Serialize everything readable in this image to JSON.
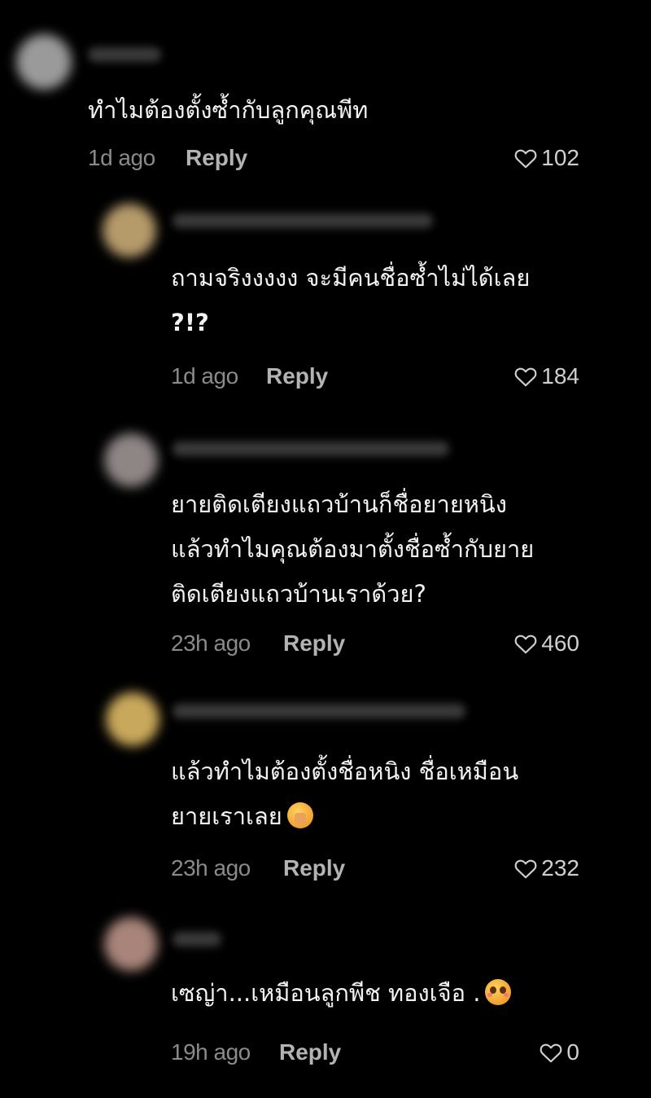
{
  "comments": [
    {
      "text_lines": [
        "ทำไมต้องตั้งซ้ำกับลูกคุณพีท"
      ],
      "time": "1d ago",
      "reply_label": "Reply",
      "likes": "102",
      "avatar_color": "#9a9a9a"
    },
    {
      "text_lines": [
        "ถามจริงงงงง จะมีคนชื่อซ้ำไม่ได้เลย",
        "?!?"
      ],
      "time": "1d ago",
      "reply_label": "Reply",
      "likes": "184",
      "avatar_color": "#b59a6a"
    },
    {
      "text_lines": [
        "ยายติดเตียงแถวบ้านก็ชื่อยายหนิง",
        "แล้วทำไมคุณต้องมาตั้งชื่อซ้ำกับยาย",
        "ติดเตียงแถวบ้านเราด้วย?"
      ],
      "time": "23h ago",
      "reply_label": "Reply",
      "likes": "460",
      "avatar_color": "#8e8585"
    },
    {
      "text_lines": [
        "แล้วทำไมต้องตั้งชื่อหนิง ชื่อเหมือน",
        "ยายเราเลย"
      ],
      "emoji": "shushing-face-emoji",
      "time": "23h ago",
      "reply_label": "Reply",
      "likes": "232",
      "avatar_color": "#c8a85a"
    },
    {
      "text_lines": [
        "เซญ่า...เหมือนลูกพีช ทองเจือ ."
      ],
      "emoji": "pleading-face-emoji",
      "time": "19h ago",
      "reply_label": "Reply",
      "likes": "0",
      "avatar_color": "#a8847a"
    }
  ]
}
